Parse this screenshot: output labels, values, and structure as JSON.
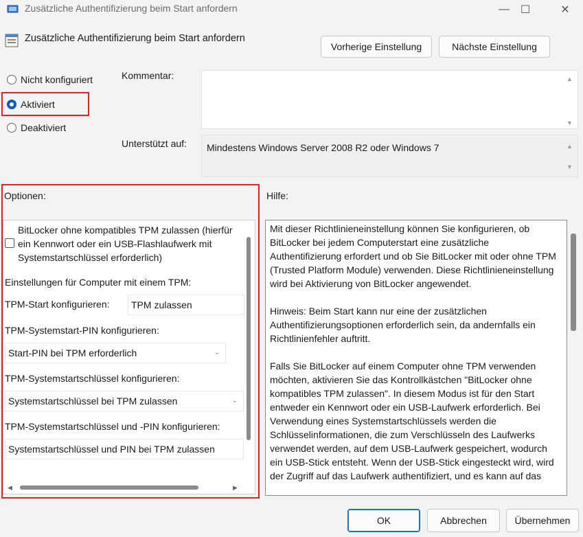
{
  "window": {
    "title": "Zusätzliche Authentifizierung beim Start anfordern",
    "minimize_glyph": "—",
    "maximize_glyph": "☐",
    "close_glyph": "✕"
  },
  "header": {
    "policy_title": "Zusätzliche Authentifizierung beim Start anfordern",
    "prev_button": "Vorherige Einstellung",
    "next_button": "Nächste Einstellung"
  },
  "state": {
    "options": [
      {
        "label": "Nicht konfiguriert",
        "selected": false
      },
      {
        "label": "Aktiviert",
        "selected": true
      },
      {
        "label": "Deaktiviert",
        "selected": false
      }
    ]
  },
  "comment": {
    "label": "Kommentar:",
    "value": ""
  },
  "supported": {
    "label": "Unterstützt auf:",
    "value": "Mindestens Windows Server 2008 R2 oder Windows 7"
  },
  "options_panel": {
    "label": "Optionen:",
    "checkbox_line1": "BitLocker ohne kompatibles TPM zulassen (hierfür",
    "checkbox_line2": "ein Kennwort oder ein USB-Flashlaufwerk mit",
    "checkbox_line3": "Systemstartschlüssel erforderlich)",
    "checkbox_checked": false,
    "tpm_heading": "Einstellungen für Computer mit einem TPM:",
    "tpm_start_label": "TPM-Start konfigurieren:",
    "tpm_start_value": "TPM zulassen",
    "tpm_pin_label": "TPM-Systemstart-PIN konfigurieren:",
    "tpm_pin_value": "Start-PIN bei TPM erforderlich",
    "tpm_key_label": "TPM-Systemstartschlüssel konfigurieren:",
    "tpm_key_value": "Systemstartschlüssel bei TPM zulassen",
    "tpm_keypin_label": "TPM-Systemstartschlüssel und -PIN konfigurieren:",
    "tpm_keypin_value": "Systemstartschlüssel und PIN bei TPM zulassen"
  },
  "help": {
    "label": "Hilfe:",
    "paragraphs": [
      "Mit dieser Richtlinieneinstellung können Sie konfigurieren, ob BitLocker bei jedem Computerstart eine zusätzliche Authentifizierung erfordert und ob Sie BitLocker mit oder ohne TPM (Trusted Platform Module) verwenden. Diese Richtlinieneinstellung wird bei Aktivierung von BitLocker angewendet.",
      "Hinweis: Beim Start kann nur eine der zusätzlichen Authentifizierungsoptionen erforderlich sein, da andernfalls ein Richtlinienfehler auftritt.",
      "Falls Sie BitLocker auf einem Computer ohne TPM verwenden möchten, aktivieren Sie das Kontrollkästchen \"BitLocker ohne kompatibles TPM zulassen\". In diesem Modus ist für den Start entweder ein Kennwort oder ein USB-Laufwerk erforderlich. Bei Verwendung eines Systemstartschlüssels werden die Schlüsselinformationen, die zum Verschlüsseln des Laufwerks verwendet werden, auf dem USB-Laufwerk gespeichert, wodurch ein USB-Stick entsteht. Wenn der USB-Stick eingesteckt wird, wird der Zugriff auf das Laufwerk authentifiziert, und es kann auf das"
    ]
  },
  "footer": {
    "ok": "OK",
    "cancel": "Abbrechen",
    "apply": "Übernehmen"
  },
  "colors": {
    "highlight_border": "#dd2222",
    "radio_selected": "#0f5bbd",
    "primary_button_border": "#1f6fc5"
  }
}
